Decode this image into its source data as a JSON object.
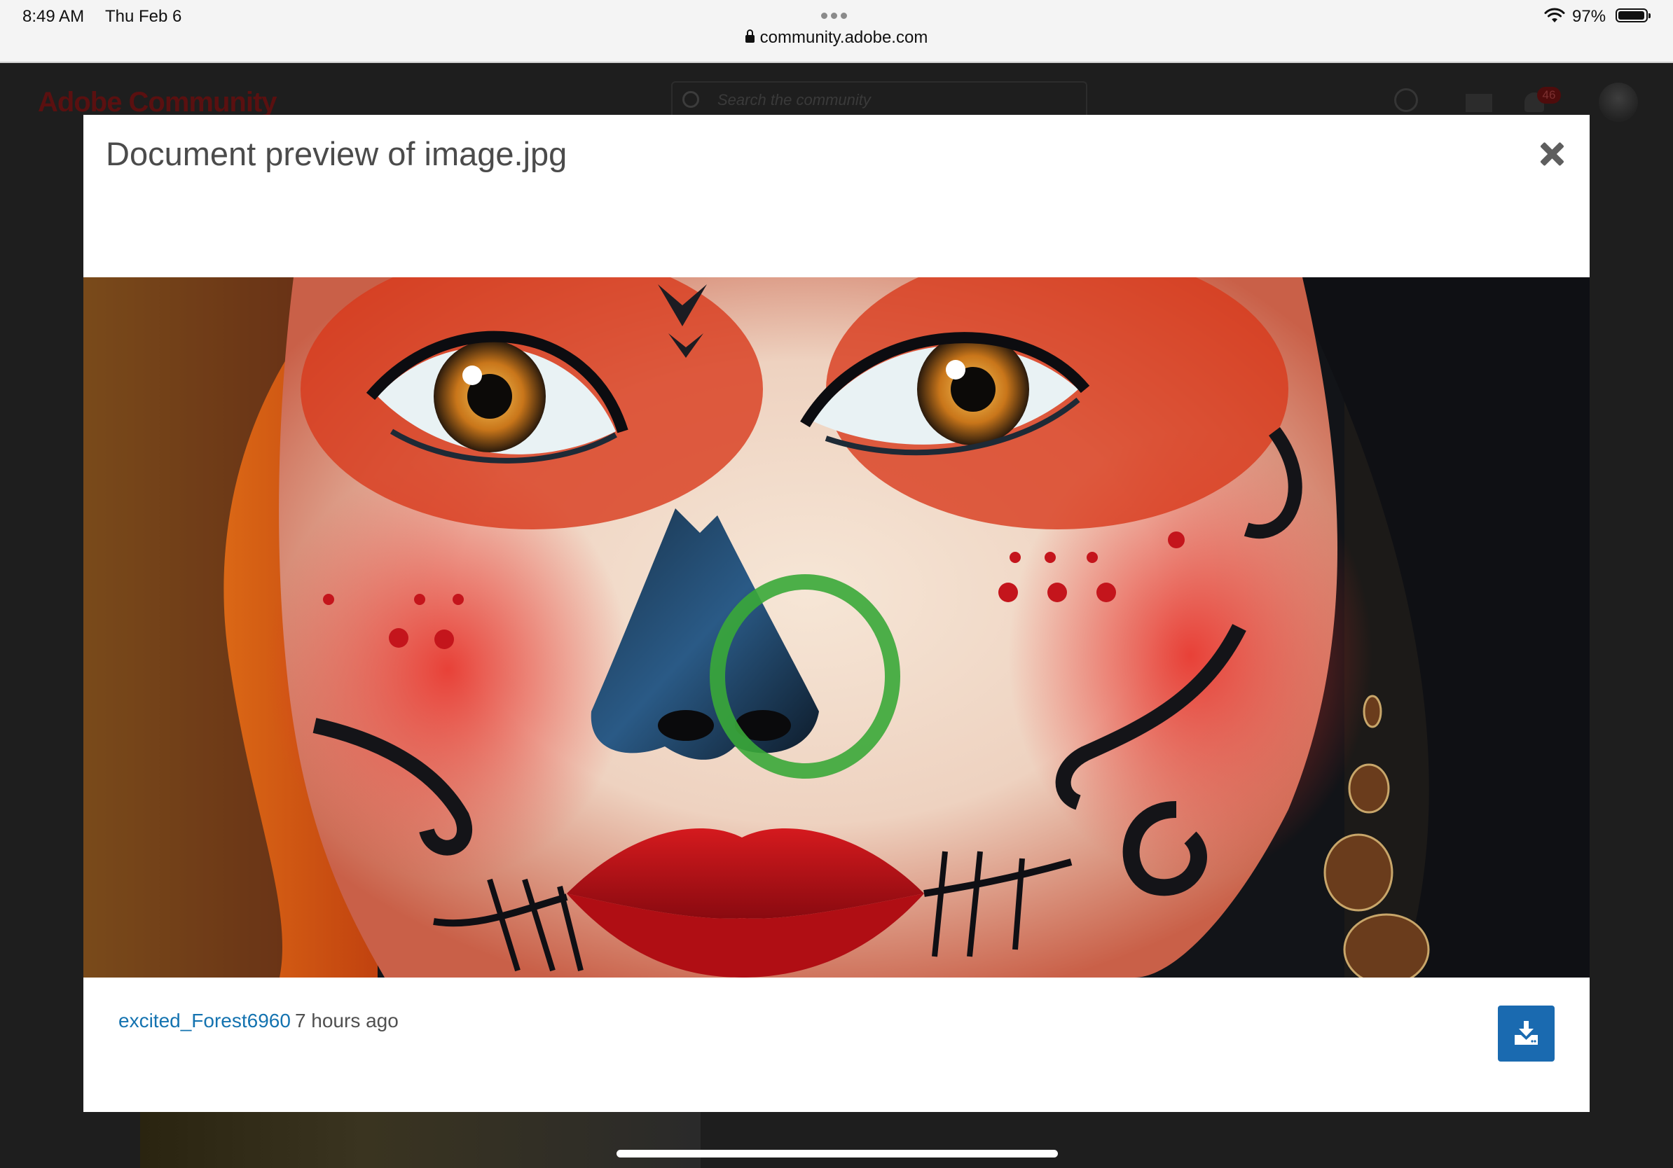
{
  "status_bar": {
    "time": "8:49 AM",
    "date": "Thu Feb 6",
    "url": "community.adobe.com",
    "battery_percent": "97%",
    "battery_level": 0.97
  },
  "background_page": {
    "logo_text": "Adobe Community",
    "search_placeholder": "Search the community",
    "notification_count": "46"
  },
  "modal": {
    "title": "Document preview of image.jpg",
    "close_icon": "close-icon",
    "preview_image_description_icon": "image-preview",
    "author": "excited_Forest6960",
    "posted": "7 hours ago",
    "download_icon": "download-icon"
  },
  "colors": {
    "link": "#1473b0",
    "download_button": "#1a6ab0",
    "overlay": "#1e1e1e"
  }
}
